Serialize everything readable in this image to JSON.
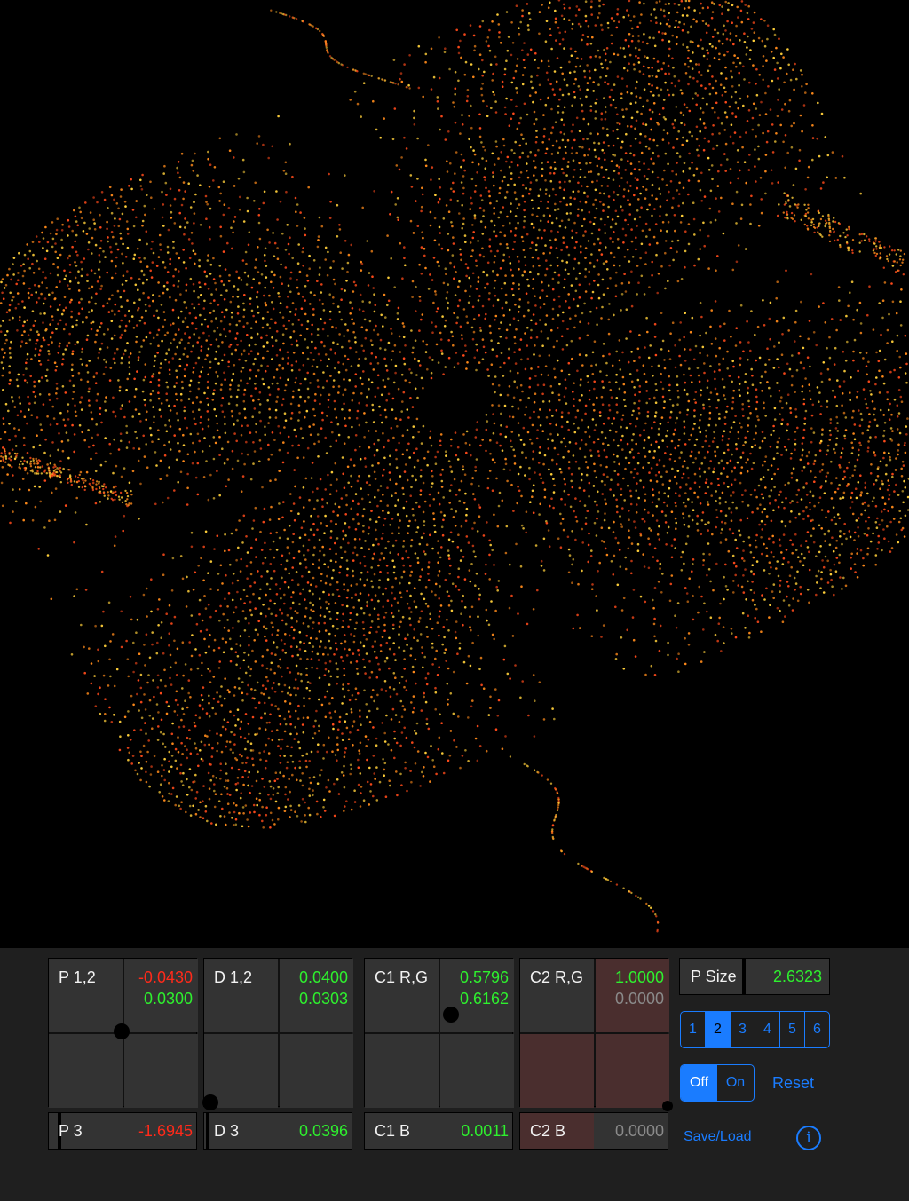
{
  "colors": {
    "accent": "#1a7cff",
    "negative_value": "#ff2a1a",
    "positive_value": "#2ef02e",
    "inactive_value": "#8a8a8a",
    "particle_a": "#ff8a1a",
    "particle_b": "#ffcf3a",
    "particle_c": "#ff4a1a"
  },
  "pads": {
    "p12": {
      "label": "P 1,2",
      "v1": "-0.0430",
      "v2": "0.0300"
    },
    "d12": {
      "label": "D 1,2",
      "v1": "0.0400",
      "v2": "0.0303"
    },
    "c1rg": {
      "label": "C1 R,G",
      "v1": "0.5796",
      "v2": "0.6162"
    },
    "c2rg": {
      "label": "C2 R,G",
      "v1": "1.0000",
      "v2": "0.0000"
    }
  },
  "sliders": {
    "p3": {
      "label": "P 3",
      "value": "-1.6945"
    },
    "d3": {
      "label": "D 3",
      "value": "0.0396"
    },
    "c1b": {
      "label": "C1 B",
      "value": "0.0011"
    },
    "c2b": {
      "label": "C2 B",
      "value": "0.0000"
    }
  },
  "psize": {
    "label": "P Size",
    "value": "2.6323"
  },
  "preset_segments": [
    "1",
    "2",
    "3",
    "4",
    "5",
    "6"
  ],
  "preset_selected": "2",
  "toggle": {
    "off_label": "Off",
    "on_label": "On",
    "selected": "Off"
  },
  "reset_label": "Reset",
  "saveload_label": "Save/Load",
  "info_glyph": "i"
}
